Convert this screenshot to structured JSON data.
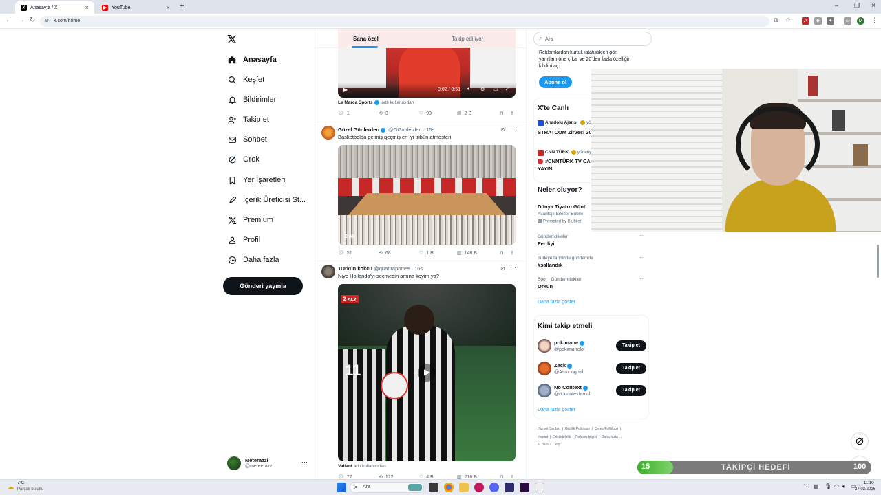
{
  "browser": {
    "tabs": [
      {
        "title": "Anasayfa / X",
        "active": true
      },
      {
        "title": "YouTube",
        "active": false
      }
    ],
    "url": "x.com/home",
    "profile_initial": "M"
  },
  "nav": {
    "items": [
      {
        "label": "Anasayfa",
        "icon": "home-icon",
        "active": true
      },
      {
        "label": "Keşfet",
        "icon": "search-icon"
      },
      {
        "label": "Bildirimler",
        "icon": "bell-icon"
      },
      {
        "label": "Takip et",
        "icon": "person-add-icon"
      },
      {
        "label": "Sohbet",
        "icon": "mail-icon"
      },
      {
        "label": "Grok",
        "icon": "grok-icon"
      },
      {
        "label": "Yer İşaretleri",
        "icon": "bookmark-icon"
      },
      {
        "label": "İçerik Üreticisi St...",
        "icon": "rocket-icon"
      },
      {
        "label": "Premium",
        "icon": "x-logo-icon"
      },
      {
        "label": "Profil",
        "icon": "profile-icon"
      },
      {
        "label": "Daha fazla",
        "icon": "more-circle-icon"
      }
    ],
    "post_button": "Gönderi yayınla",
    "account": {
      "name": "Meterazzi",
      "handle": "@meteerazzi"
    }
  },
  "feed": {
    "tabs": [
      "Sana özel",
      "Takip ediliyor"
    ],
    "tweet0": {
      "video_time": "0:02 / 0:51",
      "credit_name": "Le Marca Sports",
      "credit_suffix": "adlı kullanıcıdan",
      "stats": {
        "replies": "1",
        "retweets": "3",
        "likes": "93",
        "views": "2 B"
      }
    },
    "tweet1": {
      "name": "Güzel Günlerden",
      "handle": "@GGunlerden · 15s",
      "text": "Basketbolda gelmiş geçmiş en iyi tribün atmosferi",
      "video_time": "0:40",
      "stats": {
        "replies": "51",
        "retweets": "68",
        "likes": "1 B",
        "views": "148 B"
      }
    },
    "tweet2": {
      "name": "1Orkun kökcü",
      "handle": "@quattraportee · 16s",
      "text": "Niye Hollanda'yı seçmedin amına koyim ya?",
      "channel_badge": "ALY",
      "credit_name": "Valiant",
      "credit_suffix": "adlı kullanıcıdan",
      "stats": {
        "replies": "77",
        "retweets": "122",
        "likes": "4 B",
        "views": "216 B"
      }
    }
  },
  "right": {
    "search_placeholder": "Ara",
    "premium_text": [
      "Reklamlardan kurtul, istatistikleri gör,",
      "yanıtlanı öne çıkar ve 20'den fazla özelliğin",
      "kilidini aç."
    ],
    "subscribe_button": "Abone ol",
    "live_title": "X'te Canlı",
    "live": [
      {
        "source": "Anadolu Ajansı",
        "suffix": "yön",
        "title": "STRATCOM Zirvesi 20"
      },
      {
        "source": "CNN TÜRK",
        "suffix": "yönetiy",
        "title": "#CNNTÜRK TV CA",
        "title2": "YAYIN"
      }
    ],
    "whats_happening_title": "Neler oluyor?",
    "promo": {
      "title": "Dünya Tiyatro Günü",
      "subtitle": "Avantajlı Biletler Bubile",
      "promoted": "Promoted by Biubilet"
    },
    "trends": [
      {
        "context": "Gündemdekiler",
        "name": "Ferdiyi"
      },
      {
        "context": "Türkiye tarihinde gündemde",
        "name": "#sallandık"
      },
      {
        "context": "Spor · Gündemdekiler",
        "name": "Orkun"
      }
    ],
    "show_more": "Daha fazla göster",
    "who_to_follow_title": "Kimi takip etmeli",
    "suggestions": [
      {
        "name": "pokimane",
        "handle": "@pokimanelol"
      },
      {
        "name": "Zack",
        "handle": "@Asmongold"
      },
      {
        "name": "No Context",
        "handle": "@nocontextamcl"
      }
    ],
    "follow_label": "Takip et",
    "footer_row1": [
      "Hizmet Şartları",
      "Gizlilik Politikası",
      "Çerez Politikası"
    ],
    "footer_row2": [
      "Imprint",
      "Erişilebilirlik",
      "Reklam bilgisi",
      "Daha fazla ..."
    ],
    "copyright": "© 2026 X Corp."
  },
  "overlay": {
    "goal_current": "15",
    "goal_label": "TAKİPÇİ HEDEFİ",
    "goal_target": "100"
  },
  "taskbar": {
    "weather_temp": "7°C",
    "weather_desc": "Parçalı bulutlu",
    "search_placeholder": "Ara",
    "time": "11:10",
    "date": "27.03.2026"
  },
  "colors": {
    "accent": "#1d9bf0",
    "goal_green": "#4cbb3b",
    "dark": "#0f1419"
  }
}
